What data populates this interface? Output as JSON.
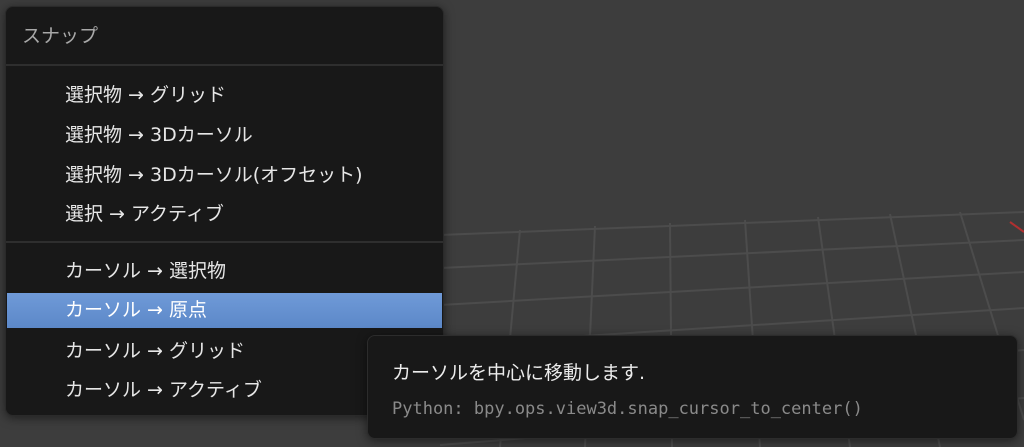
{
  "viewport": {
    "background_color": "#3d3d3d",
    "grid_color": "#4a4a4a",
    "axis_color": "#b03030"
  },
  "menu": {
    "title": "スナップ",
    "groups": [
      {
        "items": [
          {
            "label": "選択物 → グリッド"
          },
          {
            "label": "選択物 → 3Dカーソル"
          },
          {
            "label": "選択物 → 3Dカーソル(オフセット)"
          },
          {
            "label": "選択 → アクティブ"
          }
        ]
      },
      {
        "items": [
          {
            "label": "カーソル → 選択物"
          },
          {
            "label": "カーソル → 原点",
            "highlighted": true
          },
          {
            "label": "カーソル → グリッド"
          },
          {
            "label": "カーソル → アクティブ"
          }
        ]
      }
    ],
    "highlight_color": "#6f9ad8"
  },
  "tooltip": {
    "description": "カーソルを中心に移動します.",
    "python": "Python: bpy.ops.view3d.snap_cursor_to_center()"
  }
}
